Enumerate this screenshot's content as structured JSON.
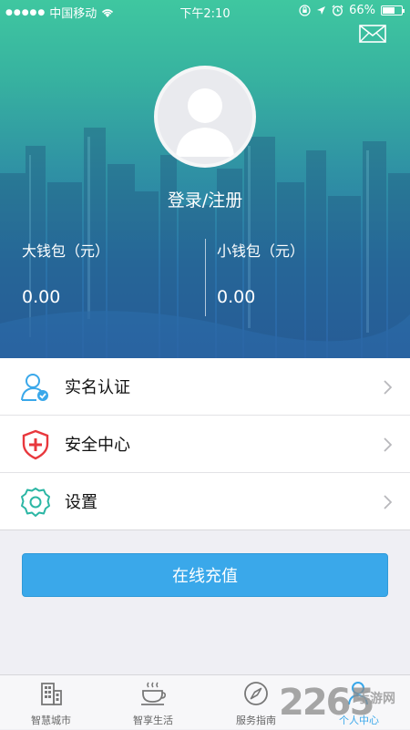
{
  "status_bar": {
    "carrier": "中国移动",
    "time": "下午2:10",
    "battery": "66%",
    "battery_level": 0.66
  },
  "header": {
    "mail_icon": "envelope-icon",
    "avatar_icon": "default-user-avatar",
    "login_label": "登录/注册"
  },
  "wallets": {
    "big": {
      "label": "大钱包（元）",
      "value": "0.00"
    },
    "small": {
      "label": "小钱包（元）",
      "value": "0.00"
    }
  },
  "menu": {
    "items": [
      {
        "label": "实名认证",
        "icon": "user-verify-icon",
        "color": "#3aa8ea"
      },
      {
        "label": "安全中心",
        "icon": "shield-plus-icon",
        "color": "#e8383d"
      },
      {
        "label": "设置",
        "icon": "gear-icon",
        "color": "#2bb6a4"
      }
    ]
  },
  "recharge": {
    "label": "在线充值"
  },
  "tabbar": {
    "items": [
      {
        "label": "智慧城市",
        "icon": "building-icon"
      },
      {
        "label": "智享生活",
        "icon": "coffee-icon"
      },
      {
        "label": "服务指南",
        "icon": "compass-icon"
      },
      {
        "label": "个人中心",
        "icon": "person-icon",
        "active": true
      }
    ]
  },
  "watermark": {
    "number": "2265",
    "text": "手游网"
  },
  "colors": {
    "accent": "#3aa8ea",
    "header_top": "#3fc7a0",
    "header_bottom": "#2b63a6"
  }
}
